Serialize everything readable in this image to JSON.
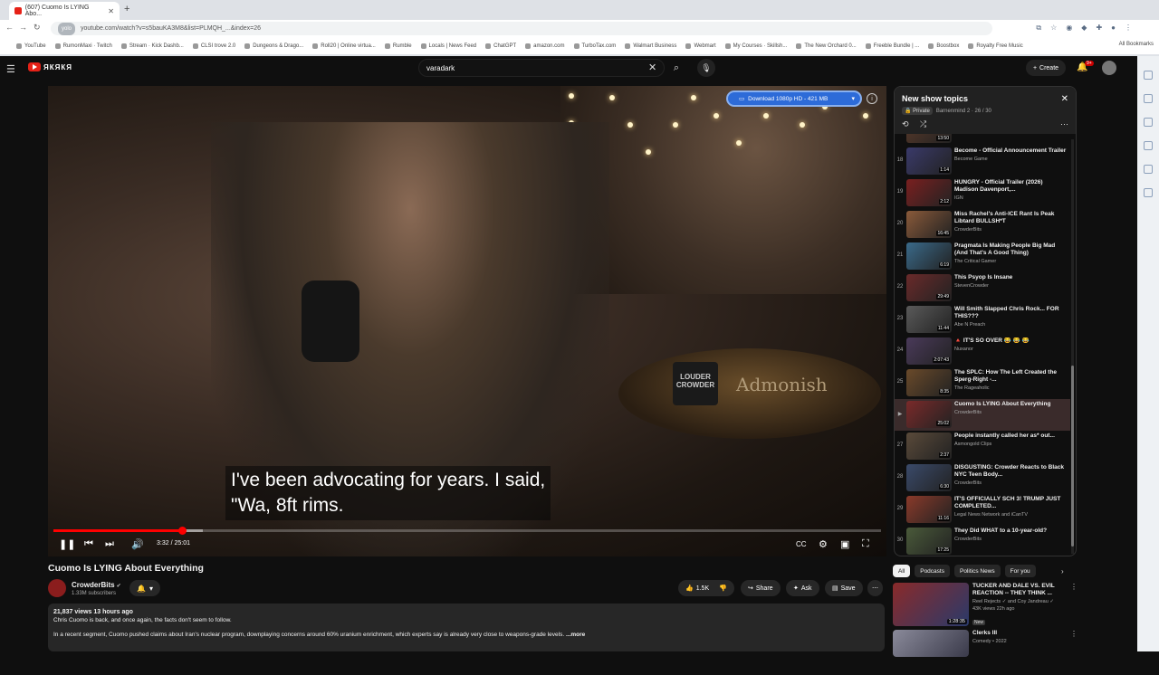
{
  "browser": {
    "tab_title": "(607) Cuomo Is LYING Abo...",
    "new_tab": "+",
    "url_chip": "yolo",
    "url": "youtube.com/watch?v=s5bauKA3M8&list=PLMQH_...&index=26",
    "bookmarks": [
      "YouTube",
      "RumonMaxi · Twitch",
      "Stream · Kick Dashb...",
      "CLSI trove 2.0",
      "Dungeons & Drago...",
      "Roll20 | Online virtua...",
      "Rumble",
      "Locals | News Feed",
      "ChatGPT",
      "amazon.com",
      "TurboTax.com",
      "Walmart Business",
      "Webmart",
      "My Courses · Skillsh...",
      "The New Orchard 0...",
      "Freeble Bundle | ...",
      "Boostbox",
      "Royalty Free Music"
    ],
    "all_bookmarks": "All Bookmarks"
  },
  "youtube": {
    "logo_text": "ЯКЯКЯ",
    "search_value": "varadark",
    "create_label": "Create",
    "notif_badge": "9+"
  },
  "player": {
    "download_label": "Download 1080p HD - 421 MB",
    "caption_line1": "I've been advocating for years. I said,",
    "caption_line2": "\"Wa, 8ft rims.",
    "time": "3:32 / 25:01",
    "progress_fraction": 0.155,
    "buffer_fraction": 0.18,
    "mug_text": "LOUDER CROWDER",
    "sign_text": "Admonish"
  },
  "video": {
    "title": "Cuomo Is LYING About Everything",
    "channel": "CrowderBits",
    "subscribers": "1.33M subscribers",
    "likes": "1.5K",
    "share": "Share",
    "ask": "Ask",
    "save": "Save",
    "desc_meta": "21,837 views  13 hours ago",
    "desc_line1": "Chris Cuomo is back, and once again, the facts don't seem to follow.",
    "desc_line2": "In a recent segment, Cuomo pushed claims about Iran's nuclear program, downplaying concerns around 60% uranium enrichment, which experts say is already very close to weapons-grade levels.",
    "desc_more": "...more"
  },
  "playlist": {
    "title": "New show topics",
    "private": "Private",
    "meta": "Barnenmind 2 · 26 / 30",
    "items": [
      {
        "num": "",
        "title": "",
        "channel": "Asmongold TV",
        "duration": "13:50"
      },
      {
        "num": "18",
        "title": "Become - Official Announcement Trailer",
        "channel": "Become Game",
        "duration": "1:14"
      },
      {
        "num": "19",
        "title": "HUNGRY - Official Trailer (2026) Madison Davenport,...",
        "channel": "IGN",
        "duration": "2:12"
      },
      {
        "num": "20",
        "title": "Miss Rachel's Anti-ICE Rant Is Peak Libtard BULLSH*T",
        "channel": "CrowderBits",
        "duration": "16:45"
      },
      {
        "num": "21",
        "title": "Pragmata Is Making People Big Mad (And That's A Good Thing)",
        "channel": "The Critical Gamer",
        "duration": "6:19"
      },
      {
        "num": "22",
        "title": "This Psyop Is Insane",
        "channel": "StevenCrowder",
        "duration": "29:49"
      },
      {
        "num": "23",
        "title": "Will Smith Slapped Chris Rock... FOR THIS???",
        "channel": "Abe N Preach",
        "duration": "11:44"
      },
      {
        "num": "24",
        "title": "🔺 IT'S SO OVER 😂 😂 😂",
        "channel": "Nuxanor",
        "duration": "2:07:43"
      },
      {
        "num": "25",
        "title": "The SPLC: How The Left Created the Sperg-Right -...",
        "channel": "The Rageaholic",
        "duration": "8:35"
      },
      {
        "num": "▶",
        "title": "Cuomo Is LYING About Everything",
        "channel": "CrowderBits",
        "duration": "25:02"
      },
      {
        "num": "27",
        "title": "People instantly called her as* out...",
        "channel": "Asmongold Clips",
        "duration": "2:37"
      },
      {
        "num": "28",
        "title": "DISGUSTING: Crowder Reacts to Black NYC Teen Body...",
        "channel": "CrowderBits",
        "duration": "6:30"
      },
      {
        "num": "29",
        "title": "IT'S OFFICIALLY SCH 3! TRUMP JUST COMPLETED...",
        "channel": "Legal News Network and iCanTV",
        "duration": "11:16"
      },
      {
        "num": "30",
        "title": "They Did WHAT to a 10-year-old?",
        "channel": "CrowderBits",
        "duration": "17:25"
      }
    ]
  },
  "chips": [
    "All",
    "Podcasts",
    "Politics News",
    "For you"
  ],
  "recommendations": [
    {
      "title": "TUCKER AND DALE VS. EVIL REACTION -- THEY THINK ...",
      "channel": "Reel Rejects ✓ and Coy Jandreau ✓",
      "meta": "43K views  22h ago",
      "badge": "New",
      "duration": "1:28:35"
    },
    {
      "title": "Clerks III",
      "channel": "Comedy • 2022",
      "meta": "",
      "badge": "",
      "duration": ""
    }
  ]
}
